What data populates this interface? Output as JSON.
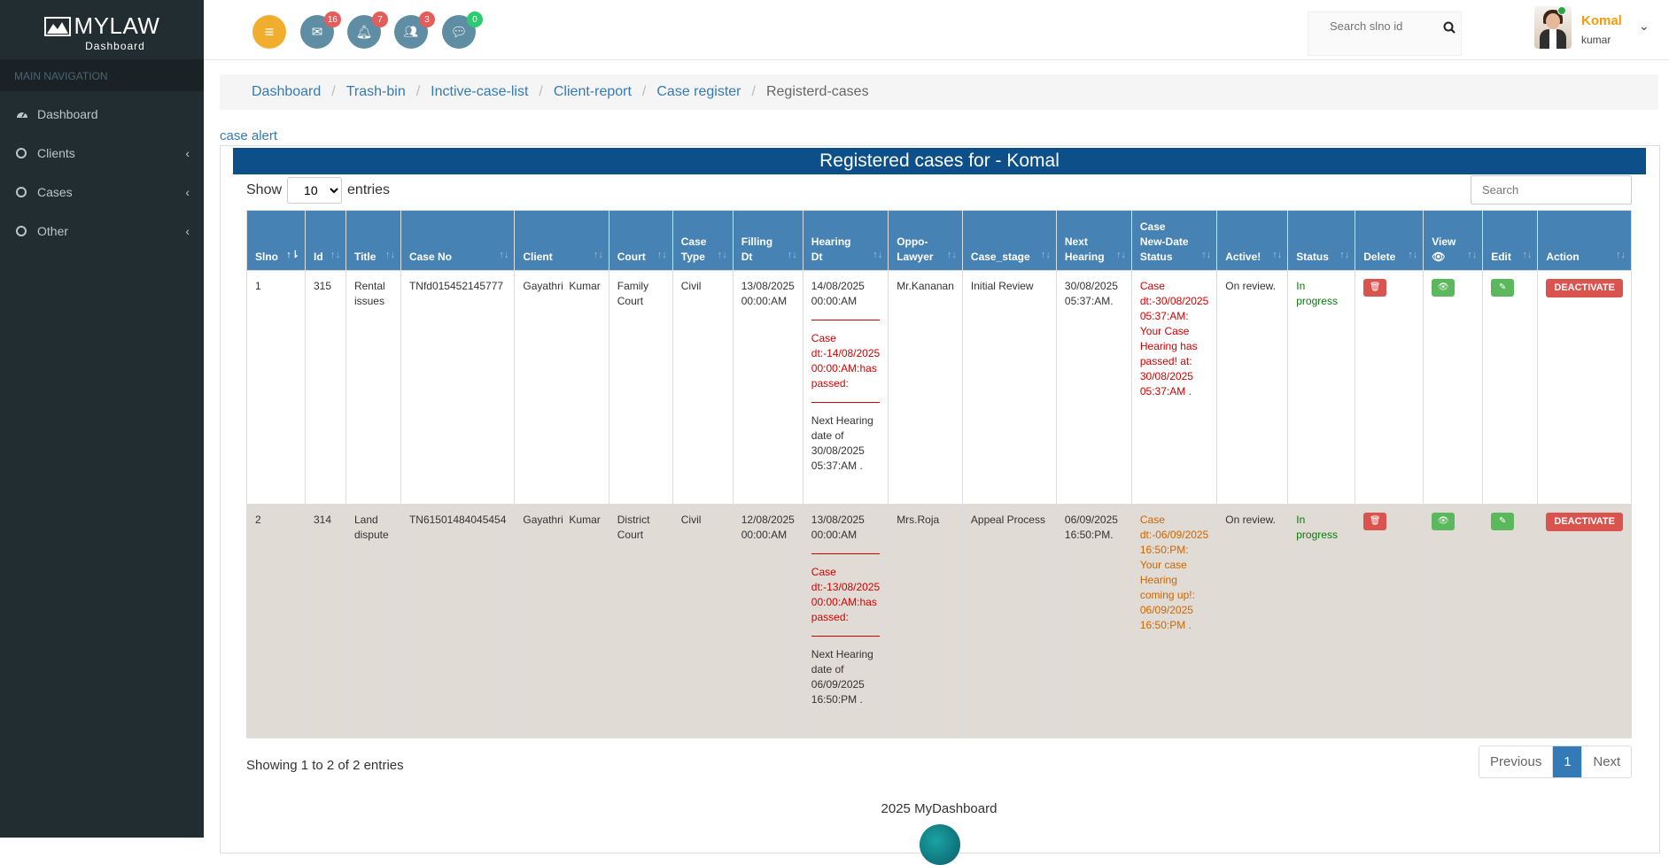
{
  "sidebar": {
    "brand": "MYLAW",
    "brand_sub": "Dashboard",
    "nav_header": "MAIN NAVIGATION",
    "items": [
      {
        "label": "Dashboard",
        "icon": "dashboard-icon"
      },
      {
        "label": "Clients",
        "icon": "circle-icon"
      },
      {
        "label": "Cases",
        "icon": "circle-icon"
      },
      {
        "label": "Other",
        "icon": "circle-icon"
      }
    ]
  },
  "topbar": {
    "badges": {
      "mail": "16",
      "bell": "7",
      "users": "3",
      "chat": "0"
    },
    "search_placeholder": "Search slno id",
    "user_name": "Komal",
    "user_sub": "kumar"
  },
  "breadcrumb": [
    "Dashboard",
    "Trash-bin",
    "Inctive-case-list",
    "Client-report",
    "Case register",
    "Registerd-cases"
  ],
  "case_alert": "case alert",
  "panel_title": "Registered cases for - Komal",
  "show_label": "Show",
  "entries_label": "entries",
  "entries_value": "10",
  "search_placeholder": "Search",
  "columns": [
    "Slno",
    "Id",
    "Title",
    "Case No",
    "Client",
    "Court",
    "Case Type",
    "Filling Dt",
    "Hearing Dt",
    "Oppo-Lawyer",
    "Case_stage",
    "Next Hearing",
    "Case New-Date Status",
    "Active!",
    "Status",
    "Delete",
    "View",
    "Edit",
    "Action"
  ],
  "rows": [
    {
      "slno": "1",
      "id": "315",
      "title": "Rental issues",
      "case_no": "TNfd015452145777",
      "client": "Gayathri  Kumar",
      "court": "Family Court",
      "case_type": "Civil",
      "filling_dt": "13/08/2025 00:00:AM",
      "hearing_dt": "14/08/2025 00:00:AM",
      "hearing_alert": "Case dt:-14/08/2025 00:00:AM:has passed:",
      "hearing_next": "Next Hearing date of 30/08/2025 05:37:AM .",
      "oppo_lawyer": "Mr.Kananan",
      "case_stage": "Initial Review",
      "next_hearing": "30/08/2025 05:37:AM.",
      "new_date_status": "Case dt:-30/08/2025 05:37:AM: Your Case Hearing has passed! at: 30/08/2025 05:37:AM .",
      "active": "On review.",
      "status": "In progress",
      "action": "DEACTIVATE"
    },
    {
      "slno": "2",
      "id": "314",
      "title": "Land dispute",
      "case_no": "TN61501484045454",
      "client": "Gayathri  Kumar",
      "court": "District Court",
      "case_type": "Civil",
      "filling_dt": "12/08/2025 00:00:AM",
      "hearing_dt": "13/08/2025 00:00:AM",
      "hearing_alert": "Case dt:-13/08/2025 00:00:AM:has passed:",
      "hearing_next": "Next Hearing date of 06/09/2025 16:50:PM .",
      "oppo_lawyer": "Mrs.Roja",
      "case_stage": "Appeal Process",
      "next_hearing": "06/09/2025 16:50:PM.",
      "new_date_status": "Case dt:-06/09/2025 16:50:PM: Your case Hearing coming up!: 06/09/2025 16:50:PM .",
      "active": "On review.",
      "status": "In progress",
      "action": "DEACTIVATE"
    }
  ],
  "info": "Showing 1 to 2 of 2 entries",
  "pager": {
    "prev": "Previous",
    "page": "1",
    "next": "Next"
  },
  "footer": "2025 MyDashboard",
  "colors": {
    "sidebar": "#222d32",
    "header": "#4682b4",
    "title_bar": "#0d5089",
    "accent": "#f39c12"
  }
}
